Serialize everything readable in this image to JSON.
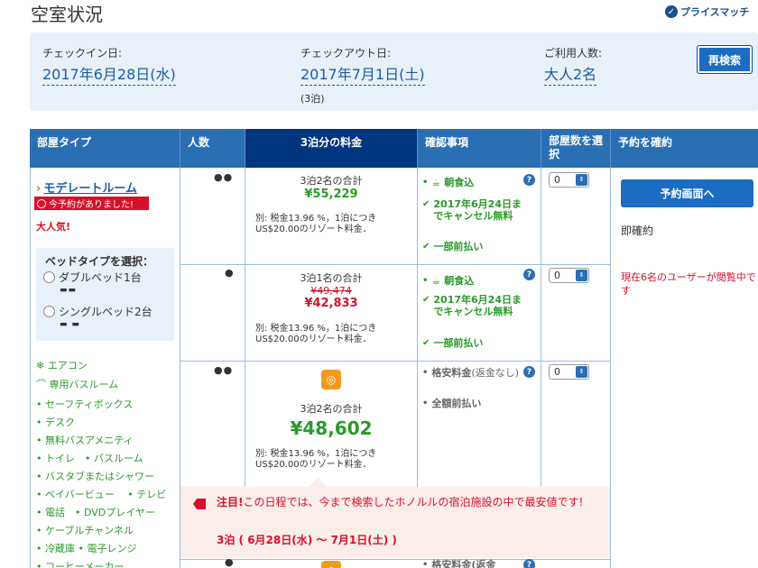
{
  "page": {
    "title": "空室状況",
    "price_match": "プライスマッチ"
  },
  "search": {
    "checkin_label": "チェックイン日:",
    "checkin_value": "2017年6月28日(水)",
    "checkout_label": "チェックアウト日:",
    "checkout_value": "2017年7月1日(土)",
    "nights": "(3泊)",
    "guests_label": "ご利用人数:",
    "guests_value": "大人2名",
    "research_button": "再検索"
  },
  "table": {
    "headers": {
      "room_type": "部屋タイプ",
      "people": "人数",
      "price": "3泊分の料金",
      "conditions": "確認事項",
      "room_count": "部屋数を選択",
      "reserve": "予約を確約"
    }
  },
  "room": {
    "name": "モデレートルーム",
    "booked_badge": "今予約がありました!",
    "popular": "大人気!",
    "bed_type_title": "ベッドタイプを選択：",
    "bed_option_1": "ダブルベッド1台",
    "bed_option_2": "シングルベッド2台",
    "amenities": [
      "エアコン",
      "専用バスルーム",
      "• セーフティボックス",
      "• デスク",
      "• 無料バスアメニティ",
      "• トイレ　• バスルーム",
      "• バスタブまたはシャワー",
      "• ベイバービュー　 • テレビ",
      "• 電話　• DVDプレイヤー",
      "• ケーブルチャンネル",
      "• 冷蔵庫 • 電子レンジ",
      "• コーヒーメーカー"
    ]
  },
  "rows": [
    {
      "price_label": "3泊2名の合計",
      "price": "¥55,229",
      "tax": "別: 税金13.96 %，1泊につき US$20.00のリゾート料金．",
      "conditions": [
        "朝食込",
        "2017年6月24日までキャンセル無料",
        "一部前払い"
      ],
      "select": "0"
    },
    {
      "price_label": "3泊1名の合計",
      "price_old": "¥49,474",
      "price": "¥42,833",
      "tax": "別: 税金13.96 %，1泊につき US$20.00のリゾート料金．",
      "conditions": [
        "朝食込",
        "2017年6月24日までキャンセル無料",
        "一部前払い"
      ],
      "select": "0"
    },
    {
      "price_label": "3泊2名の合計",
      "price": "¥48,602",
      "tax": "別: 税金13.96 %，1泊につき US$20.00のリゾート料金．",
      "conditions": [
        "格安料金(返金なし)",
        "全額前払い"
      ],
      "condition_1_main": "格安料金",
      "condition_1_note": "(返金なし)",
      "select": "0"
    },
    {
      "conditions": [
        "格安料金(返金"
      ]
    }
  ],
  "reserve": {
    "button": "予約画面へ",
    "instant": "即確約",
    "viewing": "現在6名のユーザーが閲覧中です"
  },
  "notice": {
    "emphasis": "注目!",
    "text": "この日程では、今まで検索したホノルルの宿泊施設の中で最安値です!",
    "dates": "3泊 ( 6月28日(水) ～ 7月1日(土) )"
  },
  "colors": {
    "header_blue": "#2a6fb4",
    "selected_header": "#003580",
    "green": "#2a9a2a",
    "red": "#d8102a"
  }
}
